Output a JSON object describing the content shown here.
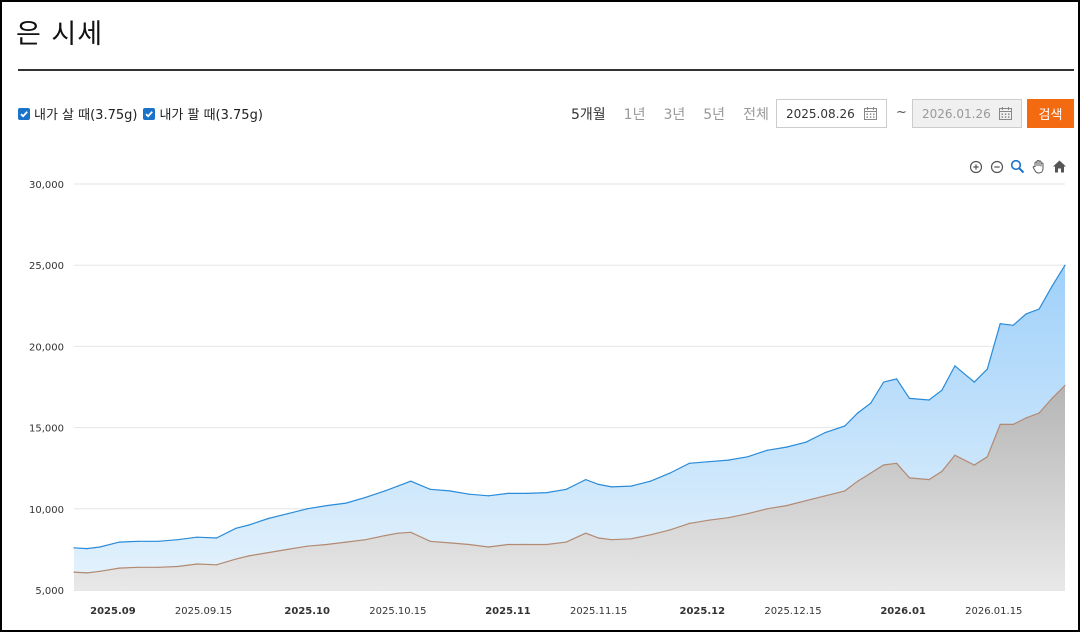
{
  "page": {
    "title": "은 시세"
  },
  "legend": {
    "buy_label": "내가 살 때(3.75g)",
    "sell_label": "내가 팔 때(3.75g)"
  },
  "periods": [
    {
      "label": "5개월",
      "active": true
    },
    {
      "label": "1년",
      "active": false
    },
    {
      "label": "3년",
      "active": false
    },
    {
      "label": "5년",
      "active": false
    },
    {
      "label": "전체",
      "active": false
    }
  ],
  "date_range": {
    "start": "2025.08.26",
    "separator": "~",
    "end": "2026.01.26"
  },
  "search_label": "검색",
  "toolbar_icons": [
    "zoom-in-icon",
    "zoom-out-icon",
    "magnifier-icon",
    "pan-hand-icon",
    "home-icon"
  ],
  "colors": {
    "accent": "#f36a10",
    "buy_line": "#2a8bd8",
    "buy_fill_top": "#9fd0fa",
    "buy_fill_bottom": "#e6f3fc",
    "sell_line": "#b38a72",
    "sell_fill_top": "#b5b5b5",
    "sell_fill_bottom": "#e8e8e8"
  },
  "chart_data": {
    "type": "area",
    "title": "",
    "xlabel": "",
    "ylabel": "",
    "ylim": [
      5000,
      30000
    ],
    "y_ticks": [
      "5,000",
      "10,000",
      "15,000",
      "20,000",
      "25,000",
      "30,000"
    ],
    "x_ticks": [
      {
        "label": "2025.09",
        "date": "2025-09-01",
        "bold": true
      },
      {
        "label": "2025.09.15",
        "date": "2025-09-15",
        "bold": false
      },
      {
        "label": "2025.10",
        "date": "2025-10-01",
        "bold": true
      },
      {
        "label": "2025.10.15",
        "date": "2025-10-15",
        "bold": false
      },
      {
        "label": "2025.11",
        "date": "2025-11-01",
        "bold": true
      },
      {
        "label": "2025.11.15",
        "date": "2025-11-15",
        "bold": false
      },
      {
        "label": "2025.12",
        "date": "2025-12-01",
        "bold": true
      },
      {
        "label": "2025.12.15",
        "date": "2025-12-15",
        "bold": false
      },
      {
        "label": "2026.01",
        "date": "2026-01-01",
        "bold": true
      },
      {
        "label": "2026.01.15",
        "date": "2026-01-15",
        "bold": false
      }
    ],
    "x": [
      "2025-08-26",
      "2025-08-28",
      "2025-08-30",
      "2025-09-02",
      "2025-09-05",
      "2025-09-08",
      "2025-09-11",
      "2025-09-14",
      "2025-09-17",
      "2025-09-20",
      "2025-09-22",
      "2025-09-25",
      "2025-09-28",
      "2025-10-01",
      "2025-10-04",
      "2025-10-07",
      "2025-10-10",
      "2025-10-13",
      "2025-10-15",
      "2025-10-17",
      "2025-10-20",
      "2025-10-23",
      "2025-10-26",
      "2025-10-29",
      "2025-11-01",
      "2025-11-04",
      "2025-11-07",
      "2025-11-10",
      "2025-11-13",
      "2025-11-15",
      "2025-11-17",
      "2025-11-20",
      "2025-11-23",
      "2025-11-26",
      "2025-11-29",
      "2025-12-02",
      "2025-12-05",
      "2025-12-08",
      "2025-12-11",
      "2025-12-14",
      "2025-12-17",
      "2025-12-20",
      "2025-12-23",
      "2025-12-25",
      "2025-12-27",
      "2025-12-29",
      "2025-12-31",
      "2026-01-02",
      "2026-01-05",
      "2026-01-07",
      "2026-01-09",
      "2026-01-12",
      "2026-01-14",
      "2026-01-16",
      "2026-01-18",
      "2026-01-20",
      "2026-01-22",
      "2026-01-24",
      "2026-01-26"
    ],
    "series": [
      {
        "name": "내가 살 때(3.75g)",
        "values": [
          7600,
          7550,
          7650,
          7950,
          8000,
          8000,
          8100,
          8250,
          8200,
          8800,
          9000,
          9400,
          9700,
          10000,
          10200,
          10350,
          10700,
          11100,
          11400,
          11700,
          11200,
          11100,
          10900,
          10800,
          10950,
          10950,
          11000,
          11200,
          11800,
          11500,
          11350,
          11400,
          11700,
          12200,
          12800,
          12900,
          13000,
          13200,
          13600,
          13800,
          14100,
          14700,
          15100,
          15900,
          16500,
          17800,
          18000,
          16800,
          16700,
          17300,
          18800,
          17800,
          18600,
          21400,
          21300,
          22000,
          22300,
          23700,
          25000
        ]
      },
      {
        "name": "내가 팔 때(3.75g)",
        "values": [
          6100,
          6050,
          6150,
          6350,
          6400,
          6400,
          6450,
          6600,
          6550,
          6900,
          7100,
          7300,
          7500,
          7700,
          7800,
          7950,
          8100,
          8350,
          8500,
          8550,
          8000,
          7900,
          7800,
          7650,
          7800,
          7800,
          7800,
          7950,
          8500,
          8200,
          8100,
          8150,
          8400,
          8700,
          9100,
          9300,
          9450,
          9700,
          10000,
          10200,
          10500,
          10800,
          11100,
          11700,
          12200,
          12700,
          12800,
          11900,
          11800,
          12300,
          13300,
          12700,
          13200,
          15200,
          15200,
          15600,
          15900,
          16800,
          17600
        ]
      }
    ]
  }
}
